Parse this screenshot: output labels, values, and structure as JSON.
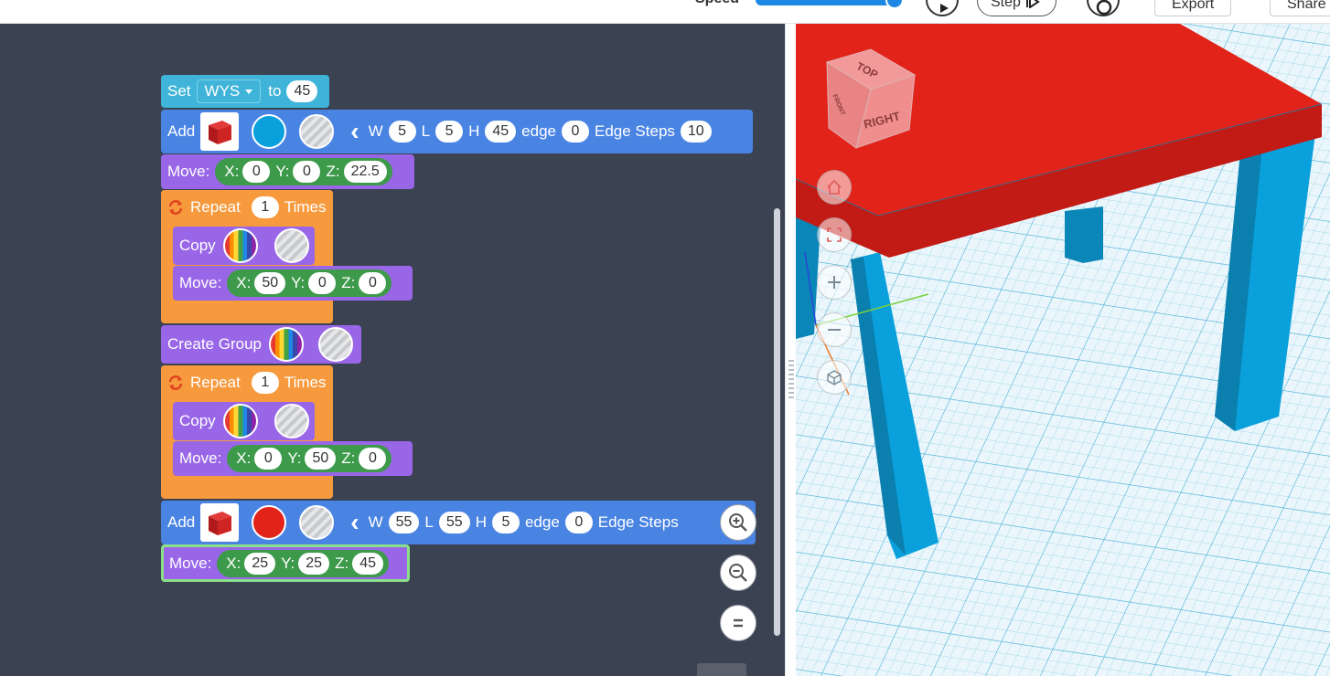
{
  "toolbar": {
    "speed_label": "Speed",
    "step_label": "Step",
    "export_label": "Export",
    "share_label": "Share"
  },
  "colors": {
    "workspace_bg": "#3b4252",
    "variable_block": "#3fb4d8",
    "shape_block": "#4a84e3",
    "transform_block": "#9966e8",
    "control_block": "#f79a3e",
    "xyz_group": "#3e9a4b",
    "tabletop": "#e2231a",
    "legs": "#0aa0dc"
  },
  "blocks": {
    "set": {
      "label": "Set",
      "variable": "WYS",
      "to_label": "to",
      "value": "45"
    },
    "add1": {
      "label": "Add",
      "icon": "red-box-icon",
      "color_swatch": "blue",
      "w_label": "W",
      "w": "5",
      "l_label": "L",
      "l": "5",
      "h_label": "H",
      "h": "45",
      "edge_label": "edge",
      "edge": "0",
      "steps_label": "Edge Steps",
      "steps": "10"
    },
    "move1": {
      "label": "Move:",
      "x_label": "X:",
      "x": "0",
      "y_label": "Y:",
      "y": "0",
      "z_label": "Z:",
      "z": "22.5"
    },
    "repeat1": {
      "label": "Repeat",
      "count": "1",
      "times_label": "Times"
    },
    "copy1": {
      "label": "Copy"
    },
    "move2": {
      "label": "Move:",
      "x_label": "X:",
      "x": "50",
      "y_label": "Y:",
      "y": "0",
      "z_label": "Z:",
      "z": "0"
    },
    "group": {
      "label": "Create Group"
    },
    "repeat2": {
      "label": "Repeat",
      "count": "1",
      "times_label": "Times"
    },
    "copy2": {
      "label": "Copy"
    },
    "move3": {
      "label": "Move:",
      "x_label": "X:",
      "x": "0",
      "y_label": "Y:",
      "y": "50",
      "z_label": "Z:",
      "z": "0"
    },
    "add2": {
      "label": "Add",
      "icon": "red-box-icon",
      "color_swatch": "red",
      "w_label": "W",
      "w": "55",
      "l_label": "L",
      "l": "55",
      "h_label": "H",
      "h": "5",
      "edge_label": "edge",
      "edge": "0",
      "steps_label": "Edge Steps"
    },
    "move4": {
      "label": "Move:",
      "x_label": "X:",
      "x": "25",
      "y_label": "Y:",
      "y": "25",
      "z_label": "Z:",
      "z": "45"
    }
  },
  "viewcube": {
    "top": "TOP",
    "right": "RIGHT",
    "front": "FRONT"
  }
}
